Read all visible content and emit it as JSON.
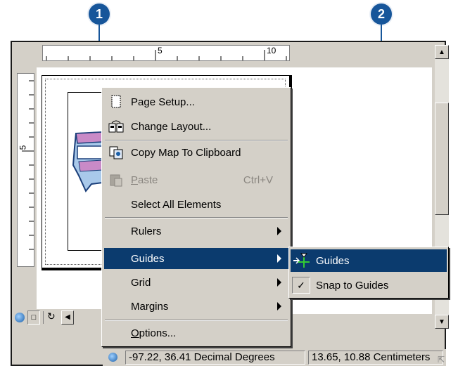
{
  "callouts": [
    "1",
    "2"
  ],
  "ruler": {
    "h_labels": [
      "5",
      "10"
    ],
    "v_labels": [
      "5"
    ]
  },
  "context_menu": {
    "items": [
      {
        "label": "Page Setup...",
        "icon": "page-setup-icon"
      },
      {
        "label": "Change Layout...",
        "icon": "change-layout-icon"
      },
      {
        "label": "Copy Map To Clipboard",
        "icon": "copy-map-icon"
      },
      {
        "label_mnemonic": "P",
        "label_rest": "aste",
        "shortcut": "Ctrl+V",
        "icon": "paste-icon",
        "disabled": true
      },
      {
        "label": "Select All Elements"
      },
      {
        "label": "Rulers",
        "submenu": true
      },
      {
        "label": "Guides",
        "submenu": true,
        "selected": true
      },
      {
        "label": "Grid",
        "submenu": true
      },
      {
        "label": "Margins",
        "submenu": true
      },
      {
        "label_mnemonic": "O",
        "label_rest": "ptions..."
      }
    ]
  },
  "guides_submenu": {
    "items": [
      {
        "label": "Guides",
        "icon": "guides-icon",
        "selected": true
      },
      {
        "label": "Snap to Guides",
        "icon": "checkmark-icon",
        "checked": true
      }
    ]
  },
  "status_bar": {
    "coordinates": "-97.22, 36.41 Decimal Degrees",
    "page_units": "13.65, 10.88 Centimeters"
  },
  "colors": {
    "selection": "#0b3b6e",
    "callout": "#17569a",
    "face": "#d4d0c8"
  }
}
